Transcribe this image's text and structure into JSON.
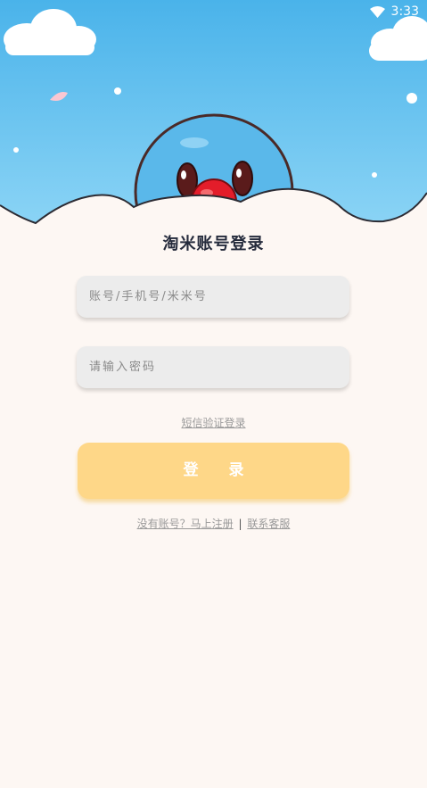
{
  "status_bar": {
    "time": "3:33",
    "wifi_icon": "wifi-icon"
  },
  "page": {
    "title": "淘米账号登录"
  },
  "form": {
    "account_placeholder": "账号/手机号/米米号",
    "password_placeholder": "请输入密码",
    "sms_login_label": "短信验证登录",
    "login_label": "登 录"
  },
  "footer": {
    "register_label": "没有账号？马上注册",
    "separator": "|",
    "support_label": "联系客服"
  },
  "colors": {
    "sky_top": "#4ab3ea",
    "sky_bottom": "#8fd6f6",
    "page_bg": "#fdf7f3",
    "login_button": "#fed788",
    "mascot": "#5ab8ea",
    "mascot_nose": "#e31d2a"
  }
}
